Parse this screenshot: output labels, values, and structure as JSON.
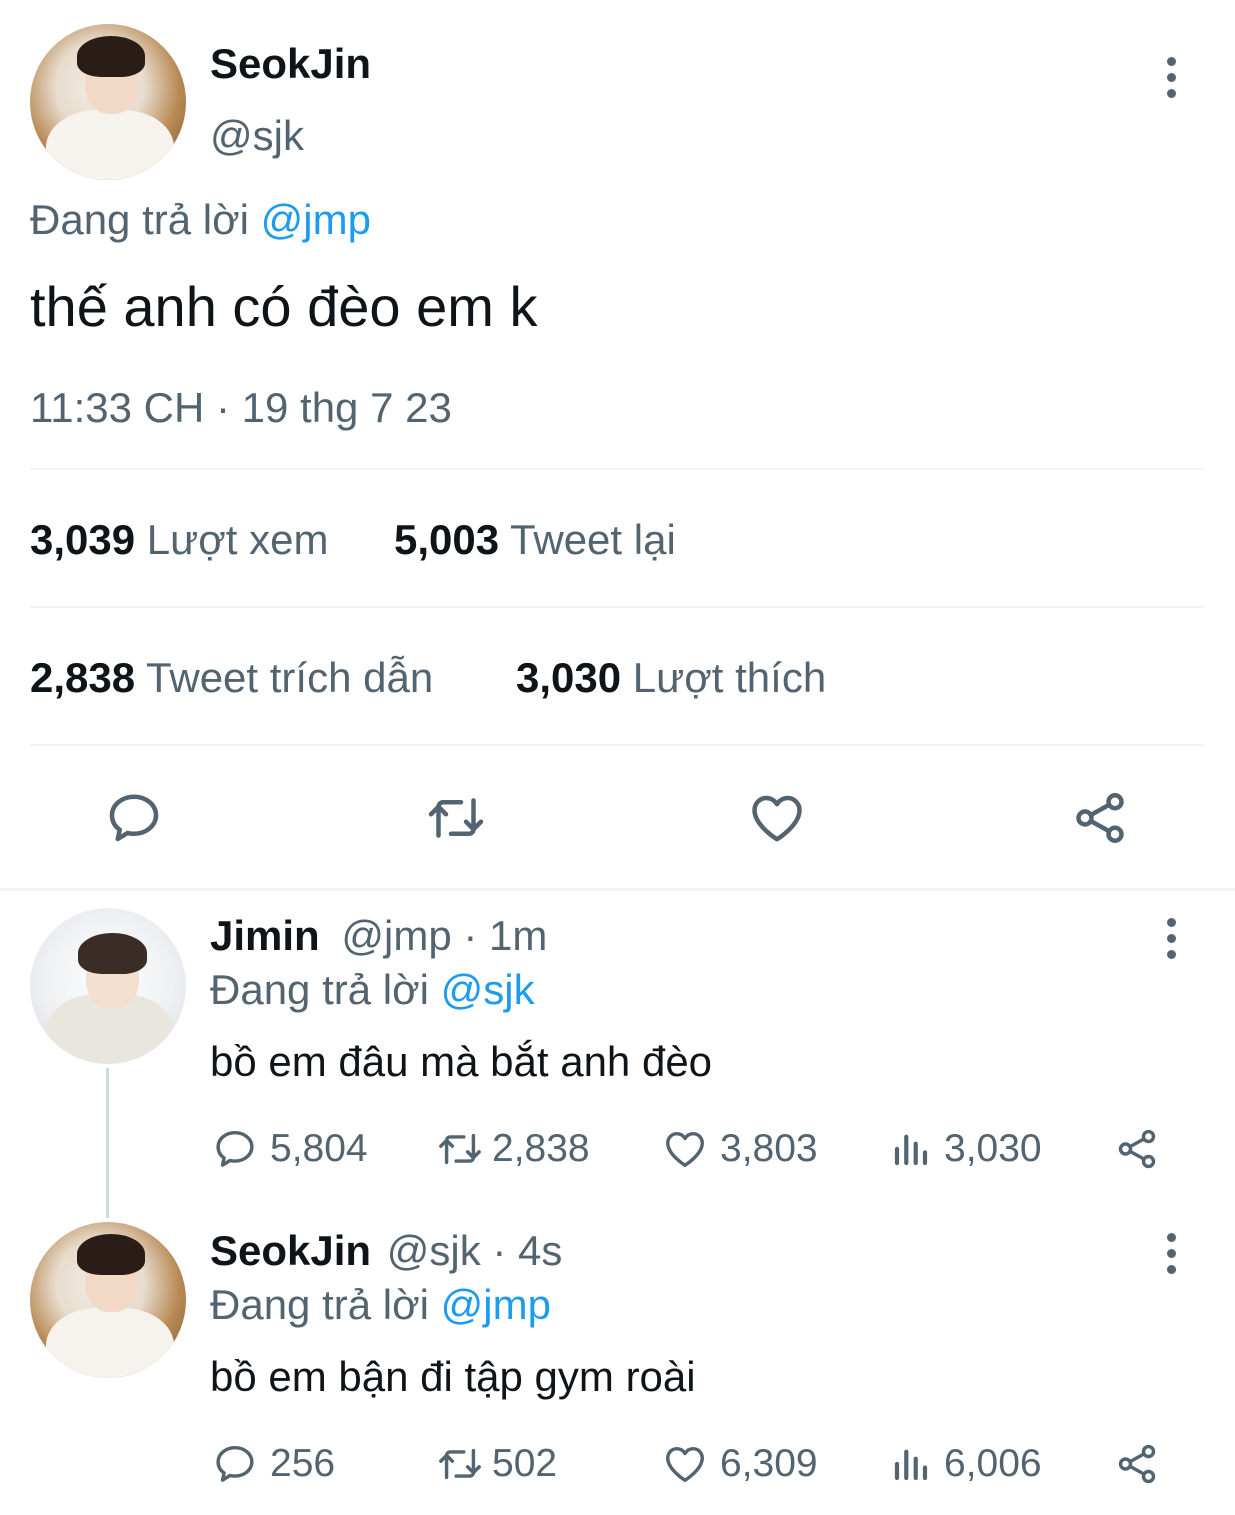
{
  "main_tweet": {
    "name": "SeokJin",
    "handle": "@sjk",
    "replying_prefix": "Đang trả lời",
    "replying_to": "@jmp",
    "text": "thế anh có đèo em k",
    "timestamp": "11:33 CH · 19 thg 7 23",
    "stats": {
      "views_count": "3,039",
      "views_label": "Lượt xem",
      "retweets_count": "5,003",
      "retweets_label": "Tweet lại",
      "quotes_count": "2,838",
      "quotes_label": "Tweet trích dẫn",
      "likes_count": "3,030",
      "likes_label": "Lượt thích"
    },
    "actions": [
      "reply-icon",
      "retweet-icon",
      "like-icon",
      "share-icon"
    ]
  },
  "replies": [
    {
      "name": "Jimin",
      "handle": "@jmp",
      "time": "· 1m",
      "replying_prefix": "Đang trả lời",
      "replying_to": "@sjk",
      "text": "bồ em đâu mà bắt anh đèo",
      "reply_count": "5,804",
      "retweet_count": "2,838",
      "like_count": "3,803",
      "view_count": "3,030"
    },
    {
      "name": "SeokJin",
      "handle": "@sjk",
      "time": "· 4s",
      "replying_prefix": "Đang trả lời",
      "replying_to": "@jmp",
      "text": "bồ em bận đi tập gym roài",
      "reply_count": "256",
      "retweet_count": "502",
      "like_count": "6,309",
      "view_count": "6,006"
    }
  ],
  "colors": {
    "text": "#0f1419",
    "secondary": "#536471",
    "link": "#1d9bf0",
    "divider": "#eff3f4"
  }
}
